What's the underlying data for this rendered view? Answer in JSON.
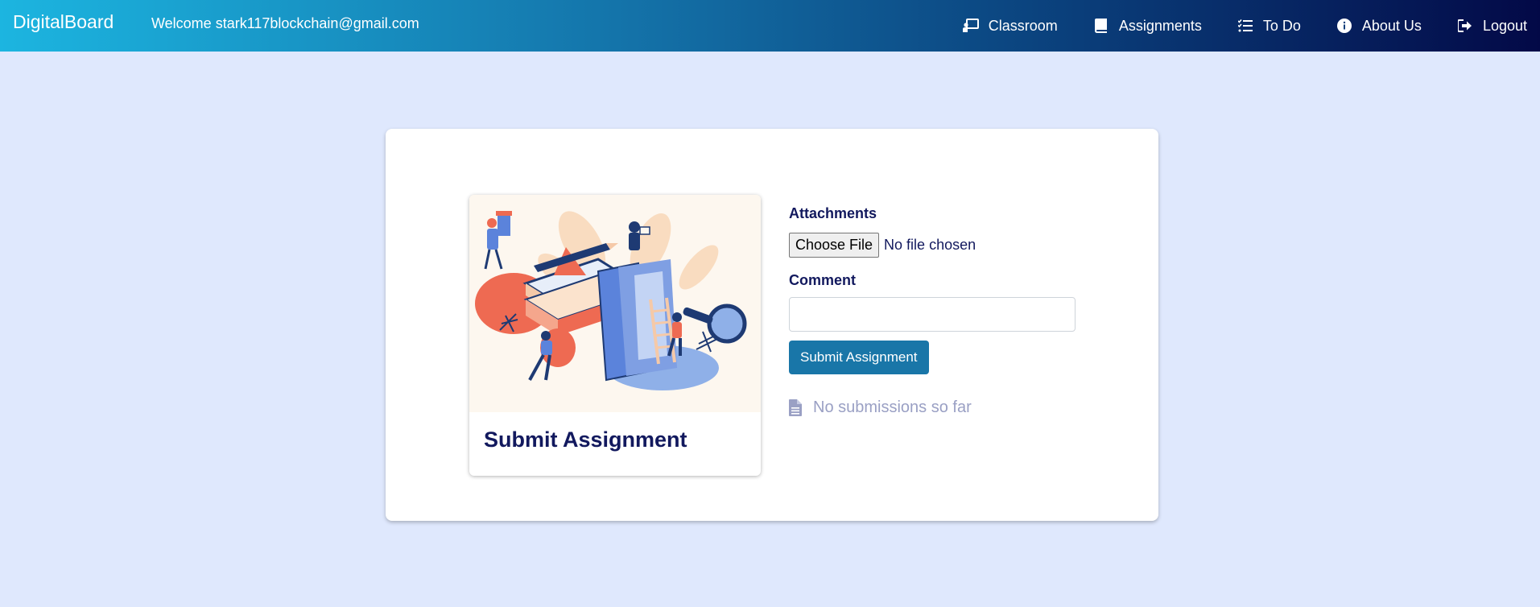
{
  "navbar": {
    "brand": "DigitalBoard",
    "welcome": "Welcome stark117blockchain@gmail.com",
    "links": [
      {
        "label": "Classroom",
        "icon": "chalkboard-teacher-icon"
      },
      {
        "label": "Assignments",
        "icon": "book-icon"
      },
      {
        "label": "To Do",
        "icon": "tasks-icon"
      },
      {
        "label": "About Us",
        "icon": "info-circle-icon"
      },
      {
        "label": "Logout",
        "icon": "sign-out-icon"
      }
    ]
  },
  "assignment_card": {
    "title": "Submit Assignment",
    "illustration": "study-books-illustration"
  },
  "form": {
    "attachments_label": "Attachments",
    "choose_file_label": "Choose File",
    "file_status": "No file chosen",
    "comment_label": "Comment",
    "comment_value": "",
    "submit_label": "Submit Assignment"
  },
  "submissions": {
    "empty_text": "No submissions so far",
    "icon": "file-icon"
  },
  "colors": {
    "background": "#dfe8fd",
    "title_text": "#12195e",
    "submit_button": "#1976a8",
    "muted_text": "#9aa0c4"
  }
}
